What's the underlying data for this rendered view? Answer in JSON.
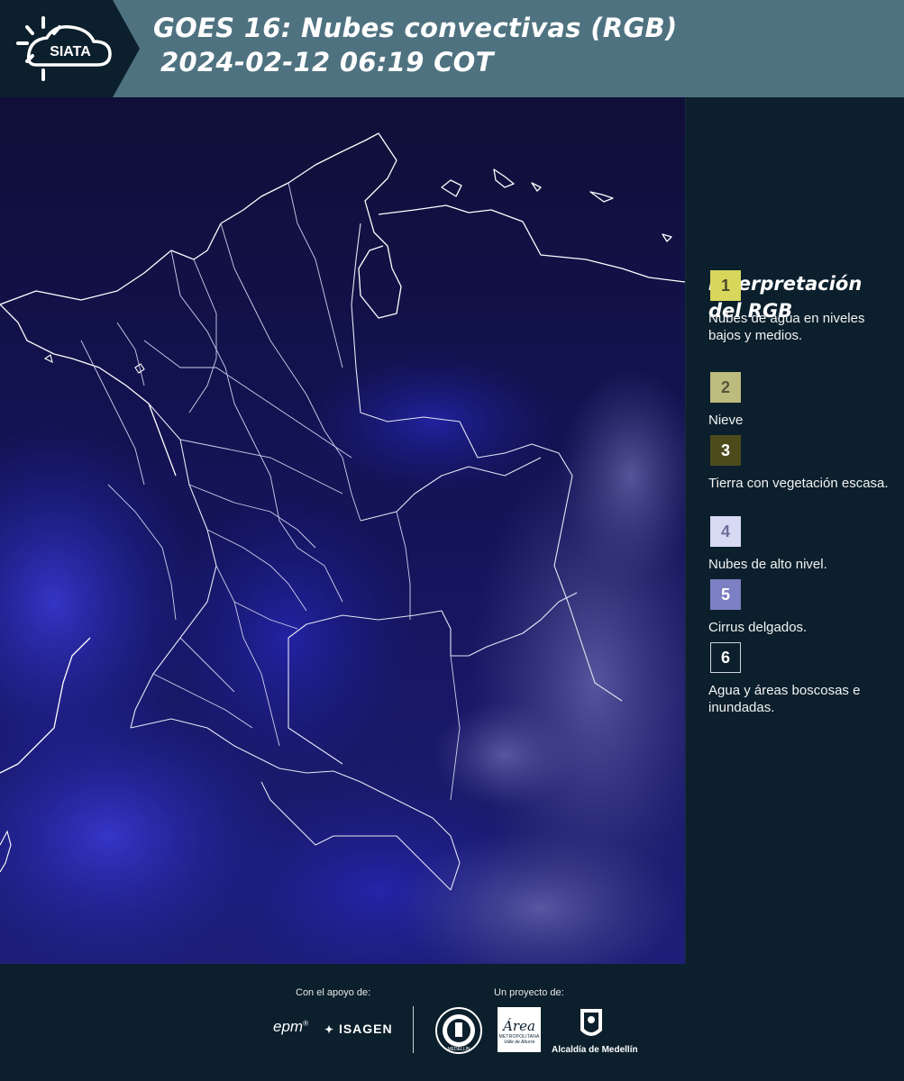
{
  "header": {
    "logo_text": "SIATA",
    "title_line1": "GOES 16: Nubes convectivas (RGB)",
    "title_line2": "2024-02-12 06:19 COT"
  },
  "legend": {
    "title_line1": "Interpretación",
    "title_line2": "del RGB",
    "items": [
      {
        "number": "1",
        "color": "#d9d65c",
        "text_color": "#4b4b2a",
        "label": "Nubes de agua en niveles bajos y medios."
      },
      {
        "number": "2",
        "color": "#bdbb7e",
        "text_color": "#56563a",
        "label": "Nieve"
      },
      {
        "number": "3",
        "color": "#4d4b1c",
        "text_color": "#ffffff",
        "label": "Tierra con vegetación escasa."
      },
      {
        "number": "4",
        "color": "#d8d9f3",
        "text_color": "#6a6f99",
        "label": "Nubes de alto nivel."
      },
      {
        "number": "5",
        "color": "#7d7fc4",
        "text_color": "#ffffff",
        "label": "Cirrus delgados."
      },
      {
        "number": "6",
        "color": "#0b1f2c",
        "text_color": "#ffffff",
        "label": "Agua y áreas boscosas e inundadas."
      }
    ]
  },
  "footer": {
    "support_label": "Con el apoyo de:",
    "project_label": "Un proyecto de:",
    "sponsor1": "epm",
    "sponsor2": "ISAGEN",
    "partner1": "MEDELLÍN",
    "partner2": "Área",
    "partner2_sub1": "METROPOLITANA",
    "partner2_sub2": "Valle de Aburrá",
    "partner3": "Alcaldía de Medellín"
  },
  "colors": {
    "header_bg": "#4f7280",
    "page_bg": "#0b1f2c",
    "map_bg": "#0f0f3e"
  }
}
